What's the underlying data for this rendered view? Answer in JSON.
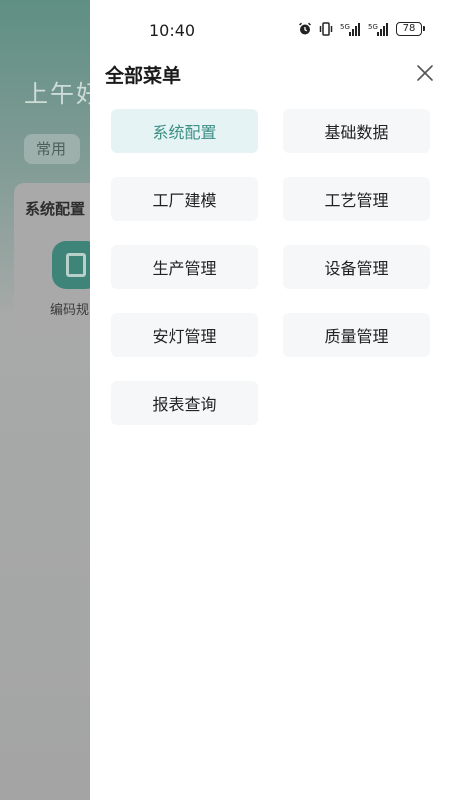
{
  "status_bar": {
    "time": "10:40",
    "battery": "78",
    "signal_labels": [
      "5G",
      "5G"
    ]
  },
  "background": {
    "greeting": "上午好",
    "chip_label": "常用",
    "card_title": "系统配置",
    "card_item_label": "编码规"
  },
  "drawer": {
    "title": "全部菜单",
    "menu_items": [
      {
        "label": "系统配置",
        "active": true
      },
      {
        "label": "基础数据",
        "active": false
      },
      {
        "label": "工厂建模",
        "active": false
      },
      {
        "label": "工艺管理",
        "active": false
      },
      {
        "label": "生产管理",
        "active": false
      },
      {
        "label": "设备管理",
        "active": false
      },
      {
        "label": "安灯管理",
        "active": false
      },
      {
        "label": "质量管理",
        "active": false
      },
      {
        "label": "报表查询",
        "active": false
      }
    ]
  },
  "colors": {
    "accent": "#3b8f85",
    "active_bg": "#e6f3f5",
    "item_bg": "#f5f7f8"
  }
}
